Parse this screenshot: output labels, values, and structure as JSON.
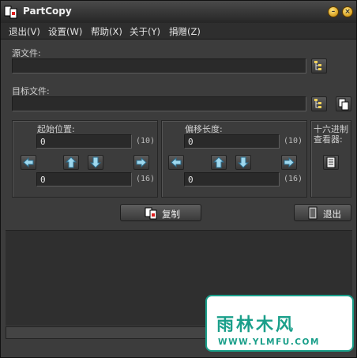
{
  "window": {
    "title": "PartCopy"
  },
  "menu": [
    "退出(V)",
    "设置(W)",
    "帮助(X)",
    "关于(Y)",
    "捐赠(Z)"
  ],
  "source": {
    "label": "源文件:",
    "value": ""
  },
  "target": {
    "label": "目标文件:",
    "value": ""
  },
  "start": {
    "label": "起始位置:",
    "dec": "0",
    "dec_unit": "(10)",
    "hex": "0",
    "hex_unit": "(16)"
  },
  "length": {
    "label": "偏移长度:",
    "dec": "0",
    "dec_unit": "(10)",
    "hex": "0",
    "hex_unit": "(16)"
  },
  "hex_viewer": {
    "label_line1": "十六进制",
    "label_line2": "查看器:"
  },
  "buttons": {
    "copy": "复制",
    "exit": "退出"
  },
  "watermark": {
    "main": "雨林木风",
    "url": "WWW.YLMFU.COM"
  },
  "colors": {
    "accent": "#1a9f8a",
    "button_orb": "#d8a020"
  }
}
